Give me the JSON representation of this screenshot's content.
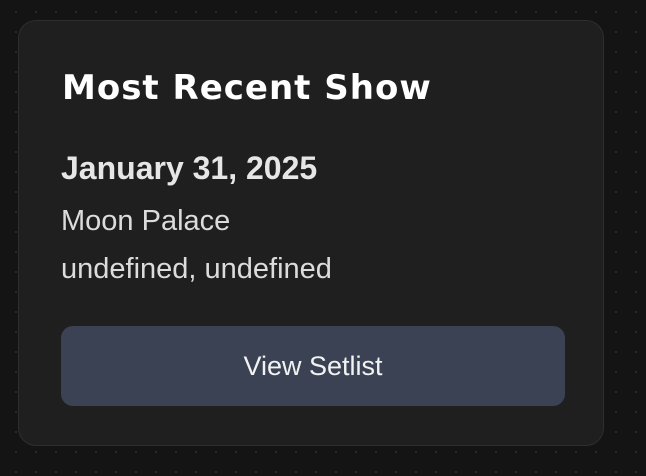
{
  "card": {
    "title": "Most Recent Show",
    "date": "January 31, 2025",
    "venue": "Moon Palace",
    "location": "undefined, undefined",
    "button_label": "View Setlist"
  },
  "colors": {
    "page_background": "#141414",
    "card_background": "#1f1f1f",
    "button_background": "#3a4253",
    "title_text": "#ffffff"
  }
}
